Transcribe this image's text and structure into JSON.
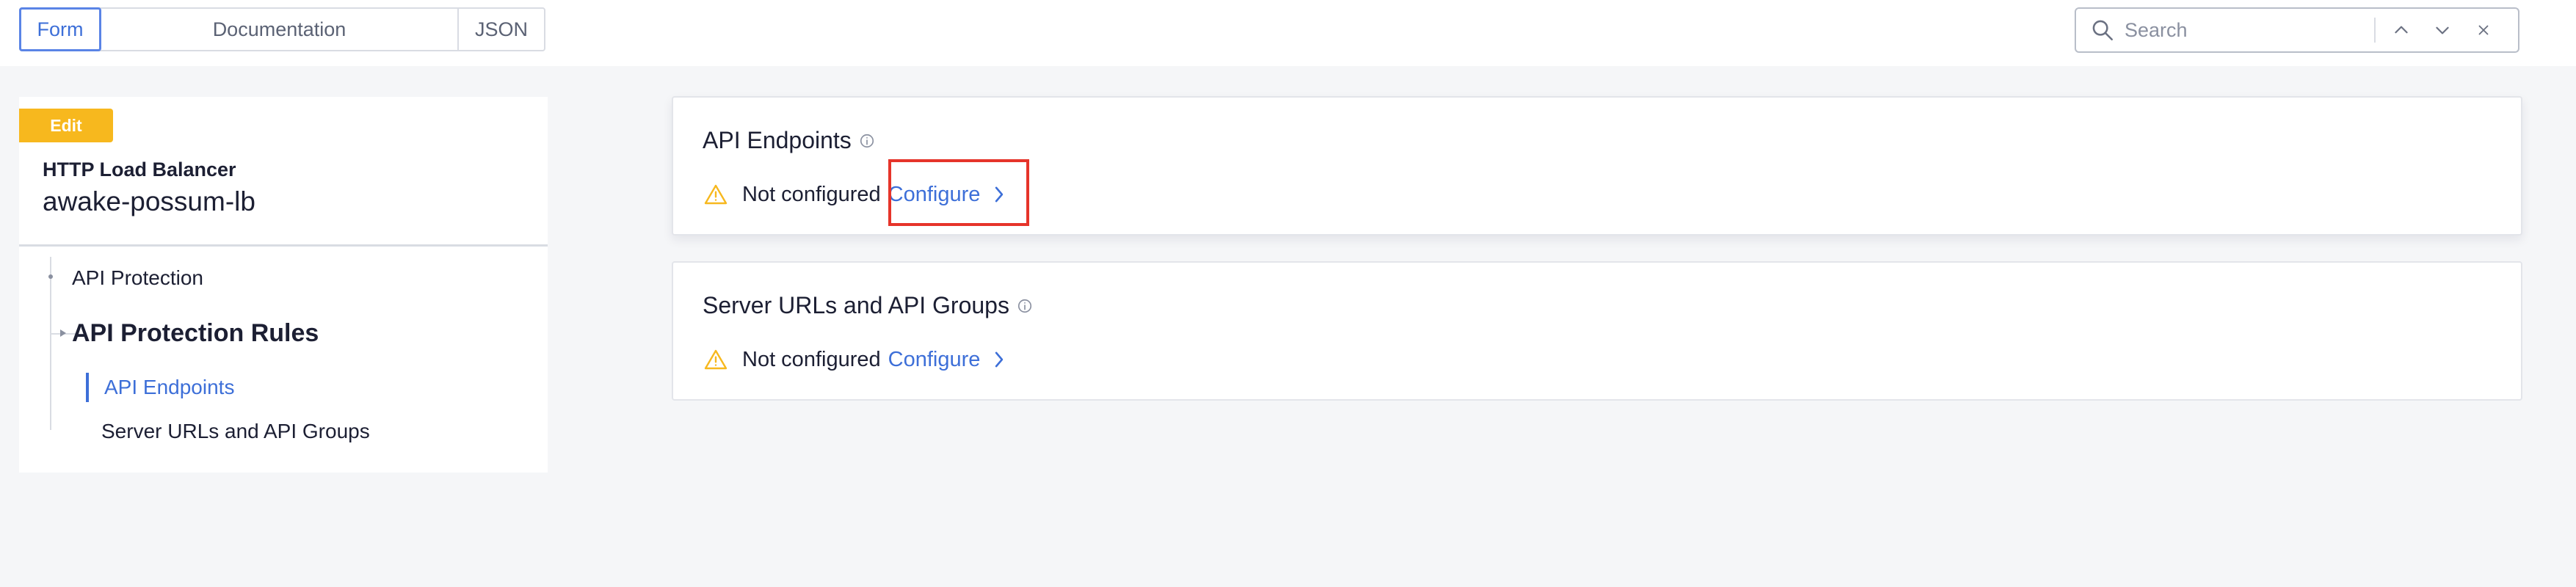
{
  "view_tabs": {
    "form": "Form",
    "documentation": "Documentation",
    "json": "JSON"
  },
  "search": {
    "placeholder": "Search",
    "value": ""
  },
  "left_panel": {
    "badge": "Edit",
    "resource_type": "HTTP Load Balancer",
    "resource_name": "awake-possum-lb",
    "nav": {
      "api_protection": "API Protection",
      "api_protection_rules": "API Protection Rules",
      "api_endpoints": "API Endpoints",
      "server_urls": "Server URLs and API Groups"
    }
  },
  "cards": [
    {
      "title": "API Endpoints",
      "status": "Not configured",
      "action": "Configure"
    },
    {
      "title": "Server URLs and API Groups",
      "status": "Not configured",
      "action": "Configure"
    }
  ],
  "colors": {
    "accent": "#3d6fd8",
    "warning": "#f7b81e",
    "highlight": "#e6342a",
    "background": "#f5f6f8"
  },
  "icons": {
    "search": "search-icon",
    "up": "chevron-up-icon",
    "down": "chevron-down-icon",
    "clear": "close-icon",
    "info": "info-icon",
    "warning": "warning-icon",
    "configure": "chevron-right-icon"
  }
}
